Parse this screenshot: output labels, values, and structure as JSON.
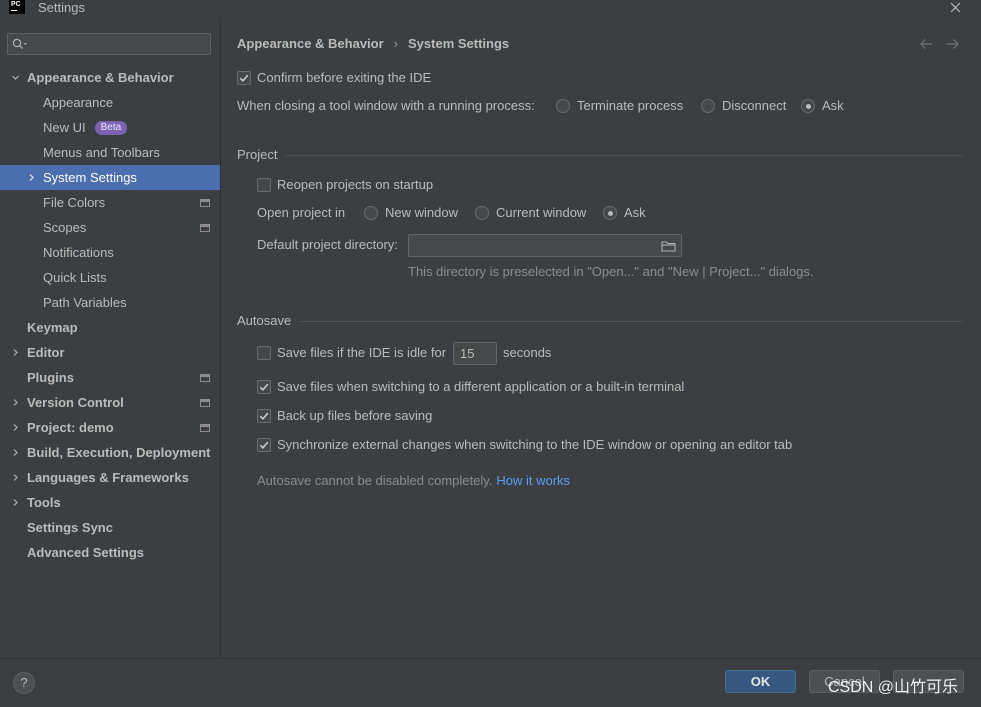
{
  "window": {
    "title": "Settings",
    "logo_text": "PC"
  },
  "icons": {
    "close": "close-icon",
    "search": "search-icon",
    "back": "arrow-left-icon",
    "forward": "arrow-right-icon",
    "browse": "folder-icon",
    "help": "help-icon",
    "expand": "chevron-right-icon",
    "collapse": "chevron-down-icon",
    "project_level": "project-settings-icon"
  },
  "colors": {
    "background": "#3c3f41",
    "text": "#bbbbbb",
    "selection": "#4b6eaf",
    "link": "#589df6",
    "hint": "#8c8c8c",
    "ok_button": "#365880",
    "badge": "#7a64b2"
  },
  "sidebar": {
    "search": {
      "value": ""
    },
    "items": [
      {
        "label": "Appearance & Behavior",
        "expandable": true,
        "expanded": true
      },
      {
        "label": "Appearance"
      },
      {
        "label": "New UI",
        "badge": "Beta"
      },
      {
        "label": "Menus and Toolbars"
      },
      {
        "label": "System Settings",
        "expandable": true,
        "selected": true
      },
      {
        "label": "File Colors",
        "icon": "project-settings-icon"
      },
      {
        "label": "Scopes",
        "icon": "project-settings-icon"
      },
      {
        "label": "Notifications"
      },
      {
        "label": "Quick Lists"
      },
      {
        "label": "Path Variables"
      },
      {
        "label": "Keymap"
      },
      {
        "label": "Editor",
        "expandable": true
      },
      {
        "label": "Plugins",
        "icon": "project-settings-icon"
      },
      {
        "label": "Version Control",
        "expandable": true,
        "icon": "project-settings-icon"
      },
      {
        "label": "Project: demo",
        "expandable": true,
        "icon": "project-settings-icon"
      },
      {
        "label": "Build, Execution, Deployment",
        "expandable": true
      },
      {
        "label": "Languages & Frameworks",
        "expandable": true
      },
      {
        "label": "Tools",
        "expandable": true
      },
      {
        "label": "Settings Sync"
      },
      {
        "label": "Advanced Settings"
      }
    ]
  },
  "breadcrumb": {
    "parent": "Appearance & Behavior",
    "separator": "›",
    "current": "System Settings"
  },
  "general": {
    "confirm_exit": {
      "label": "Confirm before exiting the IDE",
      "checked": true
    },
    "tool_window": {
      "label": "When closing a tool window with a running process:",
      "options": [
        "Terminate process",
        "Disconnect",
        "Ask"
      ],
      "selected": "Ask"
    }
  },
  "project": {
    "header": "Project",
    "reopen": {
      "label": "Reopen projects on startup",
      "checked": false
    },
    "open_in": {
      "label": "Open project in",
      "options": [
        "New window",
        "Current window",
        "Ask"
      ],
      "selected": "Ask"
    },
    "default_dir": {
      "label": "Default project directory:",
      "value": "",
      "hint": "This directory is preselected in \"Open...\" and \"New | Project...\" dialogs."
    }
  },
  "autosave": {
    "header": "Autosave",
    "idle": {
      "label": "Save files if the IDE is idle for",
      "checked": false,
      "value": "15",
      "unit": "seconds"
    },
    "on_switch": {
      "label": "Save files when switching to a different application or a built-in terminal",
      "checked": true
    },
    "backup": {
      "label": "Back up files before saving",
      "checked": true
    },
    "sync": {
      "label": "Synchronize external changes when switching to the IDE window or opening an editor tab",
      "checked": true
    },
    "note": "Autosave cannot be disabled completely.",
    "link": "How it works"
  },
  "footer": {
    "help": "?",
    "ok": "OK",
    "cancel": "Cancel"
  },
  "watermark": "CSDN @山竹可乐"
}
